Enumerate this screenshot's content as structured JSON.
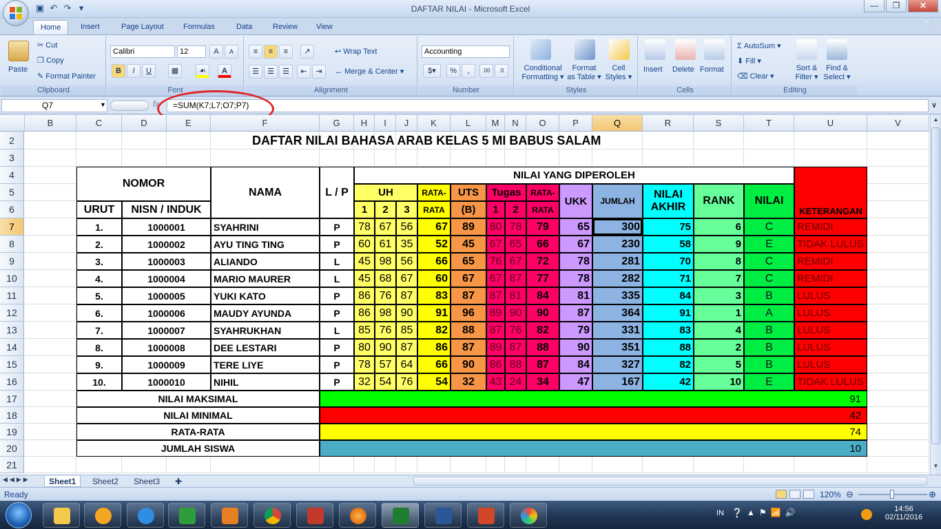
{
  "window": {
    "title": "DAFTAR NILAI - Microsoft Excel"
  },
  "ribbon_tabs": [
    "Home",
    "Insert",
    "Page Layout",
    "Formulas",
    "Data",
    "Review",
    "View"
  ],
  "clipboard": {
    "paste": "Paste",
    "cut": "Cut",
    "copy": "Copy",
    "format_painter": "Format Painter",
    "label": "Clipboard"
  },
  "font": {
    "name": "Calibri",
    "size": "12",
    "label": "Font"
  },
  "alignment": {
    "wrap": "Wrap Text",
    "merge": "Merge & Center",
    "label": "Alignment"
  },
  "number": {
    "format": "Accounting",
    "label": "Number"
  },
  "styles": {
    "cond": "Conditional",
    "cond2": "Formatting",
    "fat": "Format",
    "fat2": "as Table",
    "cell": "Cell",
    "cell2": "Styles",
    "label": "Styles"
  },
  "cells": {
    "insert": "Insert",
    "delete": "Delete",
    "format": "Format",
    "label": "Cells"
  },
  "editing": {
    "autosum": "AutoSum",
    "fill": "Fill",
    "clear": "Clear",
    "sort": "Sort &",
    "sort2": "Filter",
    "find": "Find &",
    "find2": "Select",
    "label": "Editing"
  },
  "formula_bar": {
    "name_box": "Q7",
    "formula": "=SUM(K7;L7;O7;P7)"
  },
  "columns": [
    "B",
    "C",
    "D",
    "E",
    "F",
    "G",
    "H",
    "I",
    "J",
    "K",
    "L",
    "M",
    "N",
    "O",
    "P",
    "Q",
    "R",
    "S",
    "T",
    "U",
    "V"
  ],
  "rows": [
    "2",
    "3",
    "4",
    "5",
    "6",
    "7",
    "8",
    "9",
    "10",
    "11",
    "12",
    "13",
    "14",
    "15",
    "16",
    "17",
    "18",
    "19",
    "20",
    "21"
  ],
  "sheet": {
    "title": "DAFTAR NILAI BAHASA ARAB KELAS 5 MI BABUS SALAM",
    "headers": {
      "nomor": "NOMOR",
      "urut": "URUT",
      "nisn": "NISN / INDUK",
      "nama": "NAMA",
      "lp": "L / P",
      "nilai_diperoleh": "NILAI YANG DIPEROLEH",
      "uh": "UH",
      "uh1": "1",
      "uh2": "2",
      "uh3": "3",
      "rata1a": "RATA-",
      "rata1b": "RATA",
      "uts": "UTS",
      "utsb": "(B)",
      "tugas": "Tugas",
      "t1": "1",
      "t2": "2",
      "rata2a": "RATA-",
      "rata2b": "RATA",
      "ukk": "UKK",
      "jumlah": "JUMLAH",
      "nilai_akhir1": "NILAI",
      "nilai_akhir2": "AKHIR",
      "rank": "RANK",
      "nilai": "NILAI",
      "keterangan": "KETERANGAN"
    },
    "students": [
      {
        "urut": "1.",
        "nisn": "1000001",
        "nama": "SYAHRINI",
        "lp": "P",
        "uh1": "78",
        "uh2": "67",
        "uh3": "56",
        "rata": "67",
        "uts": "89",
        "t1": "80",
        "t2": "78",
        "rata2": "79",
        "ukk": "65",
        "jumlah": "300",
        "akhir": "75",
        "rank": "6",
        "nilai": "C",
        "ket": "REMIDI"
      },
      {
        "urut": "2.",
        "nisn": "1000002",
        "nama": "AYU TING TING",
        "lp": "P",
        "uh1": "60",
        "uh2": "61",
        "uh3": "35",
        "rata": "52",
        "uts": "45",
        "t1": "67",
        "t2": "65",
        "rata2": "66",
        "ukk": "67",
        "jumlah": "230",
        "akhir": "58",
        "rank": "9",
        "nilai": "E",
        "ket": "TIDAK LULUS"
      },
      {
        "urut": "3.",
        "nisn": "1000003",
        "nama": "ALIANDO",
        "lp": "L",
        "uh1": "45",
        "uh2": "98",
        "uh3": "56",
        "rata": "66",
        "uts": "65",
        "t1": "76",
        "t2": "67",
        "rata2": "72",
        "ukk": "78",
        "jumlah": "281",
        "akhir": "70",
        "rank": "8",
        "nilai": "C",
        "ket": "REMIDI"
      },
      {
        "urut": "4.",
        "nisn": "1000004",
        "nama": "MARIO MAURER",
        "lp": "L",
        "uh1": "45",
        "uh2": "68",
        "uh3": "67",
        "rata": "60",
        "uts": "67",
        "t1": "67",
        "t2": "87",
        "rata2": "77",
        "ukk": "78",
        "jumlah": "282",
        "akhir": "71",
        "rank": "7",
        "nilai": "C",
        "ket": "REMIDI"
      },
      {
        "urut": "5.",
        "nisn": "1000005",
        "nama": "YUKI KATO",
        "lp": "P",
        "uh1": "86",
        "uh2": "76",
        "uh3": "87",
        "rata": "83",
        "uts": "87",
        "t1": "87",
        "t2": "81",
        "rata2": "84",
        "ukk": "81",
        "jumlah": "335",
        "akhir": "84",
        "rank": "3",
        "nilai": "B",
        "ket": "LULUS"
      },
      {
        "urut": "6.",
        "nisn": "1000006",
        "nama": "MAUDY AYUNDA",
        "lp": "P",
        "uh1": "86",
        "uh2": "98",
        "uh3": "90",
        "rata": "91",
        "uts": "96",
        "t1": "89",
        "t2": "90",
        "rata2": "90",
        "ukk": "87",
        "jumlah": "364",
        "akhir": "91",
        "rank": "1",
        "nilai": "A",
        "ket": "LULUS"
      },
      {
        "urut": "7.",
        "nisn": "1000007",
        "nama": "SYAHRUKHAN",
        "lp": "L",
        "uh1": "85",
        "uh2": "76",
        "uh3": "85",
        "rata": "82",
        "uts": "88",
        "t1": "87",
        "t2": "76",
        "rata2": "82",
        "ukk": "79",
        "jumlah": "331",
        "akhir": "83",
        "rank": "4",
        "nilai": "B",
        "ket": "LULUS"
      },
      {
        "urut": "8.",
        "nisn": "1000008",
        "nama": "DEE LESTARI",
        "lp": "P",
        "uh1": "80",
        "uh2": "90",
        "uh3": "87",
        "rata": "86",
        "uts": "87",
        "t1": "89",
        "t2": "87",
        "rata2": "88",
        "ukk": "90",
        "jumlah": "351",
        "akhir": "88",
        "rank": "2",
        "nilai": "B",
        "ket": "LULUS"
      },
      {
        "urut": "9.",
        "nisn": "1000009",
        "nama": "TERE LIYE",
        "lp": "P",
        "uh1": "78",
        "uh2": "57",
        "uh3": "64",
        "rata": "66",
        "uts": "90",
        "t1": "86",
        "t2": "88",
        "rata2": "87",
        "ukk": "84",
        "jumlah": "327",
        "akhir": "82",
        "rank": "5",
        "nilai": "B",
        "ket": "LULUS"
      },
      {
        "urut": "10.",
        "nisn": "1000010",
        "nama": "NIHIL",
        "lp": "P",
        "uh1": "32",
        "uh2": "54",
        "uh3": "76",
        "rata": "54",
        "uts": "32",
        "t1": "43",
        "t2": "24",
        "rata2": "34",
        "ukk": "47",
        "jumlah": "167",
        "akhir": "42",
        "rank": "10",
        "nilai": "E",
        "ket": "TIDAK LULUS"
      }
    ],
    "summary": [
      {
        "label": "NILAI MAKSIMAL",
        "value": "91",
        "color": "#00ff00"
      },
      {
        "label": "NILAI MINIMAL",
        "value": "42",
        "color": "#ff0000"
      },
      {
        "label": "RATA-RATA",
        "value": "74",
        "color": "#ffff00"
      },
      {
        "label": "JUMLAH SISWA",
        "value": "10",
        "color": "#4bacc6"
      }
    ]
  },
  "sheet_tabs": [
    "Sheet1",
    "Sheet2",
    "Sheet3"
  ],
  "status": {
    "ready": "Ready",
    "zoom": "120%"
  },
  "taskbar": {
    "lang": "IN",
    "time": "14:56",
    "date": "02/11/2016"
  },
  "colors": {
    "uh": "#ffff66",
    "rata": "#ffff00",
    "uts": "#f79646",
    "tugas": "#ff0066",
    "ukk": "#cc99ff",
    "jumlah": "#8db3e2",
    "akhir": "#00ffff",
    "rank": "#66ff99",
    "nilai": "#00ee44",
    "ket": "#ff0000"
  }
}
